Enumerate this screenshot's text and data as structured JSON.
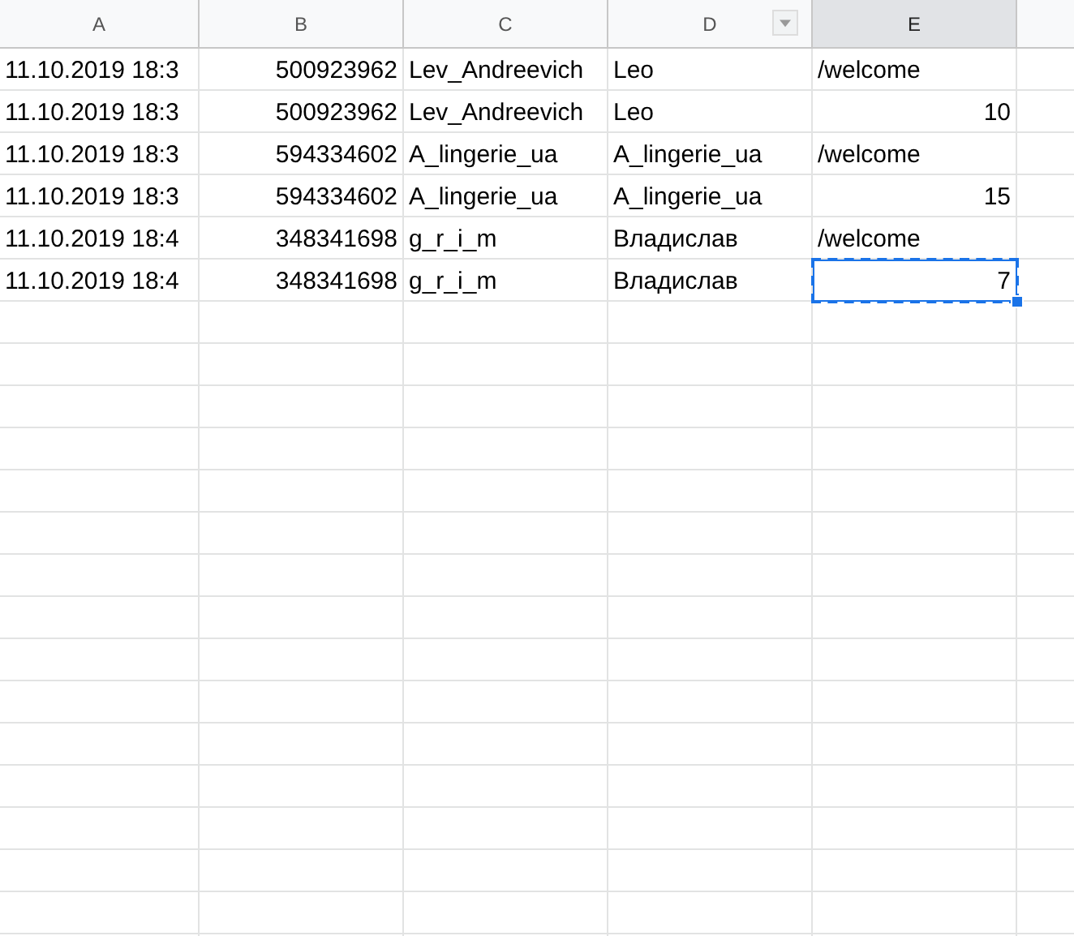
{
  "columns": [
    {
      "label": "A",
      "selected": false,
      "filter": false
    },
    {
      "label": "B",
      "selected": false,
      "filter": false
    },
    {
      "label": "C",
      "selected": false,
      "filter": false
    },
    {
      "label": "D",
      "selected": false,
      "filter": true
    },
    {
      "label": "E",
      "selected": true,
      "filter": false
    }
  ],
  "rows": [
    {
      "cells": [
        {
          "text": "11.10.2019 18:3",
          "kind": "text",
          "selected": false
        },
        {
          "text": "500923962",
          "kind": "number",
          "selected": false
        },
        {
          "text": "Lev_Andreevich",
          "kind": "text",
          "selected": false
        },
        {
          "text": "Leo",
          "kind": "text",
          "selected": false
        },
        {
          "text": "/welcome",
          "kind": "text",
          "selected": false
        }
      ]
    },
    {
      "cells": [
        {
          "text": "11.10.2019 18:3",
          "kind": "text",
          "selected": false
        },
        {
          "text": "500923962",
          "kind": "number",
          "selected": false
        },
        {
          "text": "Lev_Andreevich",
          "kind": "text",
          "selected": false
        },
        {
          "text": "Leo",
          "kind": "text",
          "selected": false
        },
        {
          "text": "10",
          "kind": "number",
          "selected": false
        }
      ]
    },
    {
      "cells": [
        {
          "text": "11.10.2019 18:3",
          "kind": "text",
          "selected": false
        },
        {
          "text": "594334602",
          "kind": "number",
          "selected": false
        },
        {
          "text": "A_lingerie_ua",
          "kind": "text",
          "selected": false
        },
        {
          "text": "A_lingerie_ua",
          "kind": "text",
          "selected": false
        },
        {
          "text": "/welcome",
          "kind": "text",
          "selected": false
        }
      ]
    },
    {
      "cells": [
        {
          "text": "11.10.2019 18:3",
          "kind": "text",
          "selected": false
        },
        {
          "text": "594334602",
          "kind": "number",
          "selected": false
        },
        {
          "text": "A_lingerie_ua",
          "kind": "text",
          "selected": false
        },
        {
          "text": "A_lingerie_ua",
          "kind": "text",
          "selected": false
        },
        {
          "text": "15",
          "kind": "number",
          "selected": false
        }
      ]
    },
    {
      "cells": [
        {
          "text": "11.10.2019 18:4",
          "kind": "text",
          "selected": false
        },
        {
          "text": "348341698",
          "kind": "number",
          "selected": false
        },
        {
          "text": "g_r_i_m",
          "kind": "text",
          "selected": false
        },
        {
          "text": "Владислав",
          "kind": "text",
          "selected": false
        },
        {
          "text": "/welcome",
          "kind": "text",
          "selected": false
        }
      ]
    },
    {
      "cells": [
        {
          "text": "11.10.2019 18:4",
          "kind": "text",
          "selected": false
        },
        {
          "text": "348341698",
          "kind": "number",
          "selected": false
        },
        {
          "text": "g_r_i_m",
          "kind": "text",
          "selected": false
        },
        {
          "text": "Владислав",
          "kind": "text",
          "selected": false
        },
        {
          "text": "7",
          "kind": "number",
          "selected": true
        }
      ]
    }
  ]
}
